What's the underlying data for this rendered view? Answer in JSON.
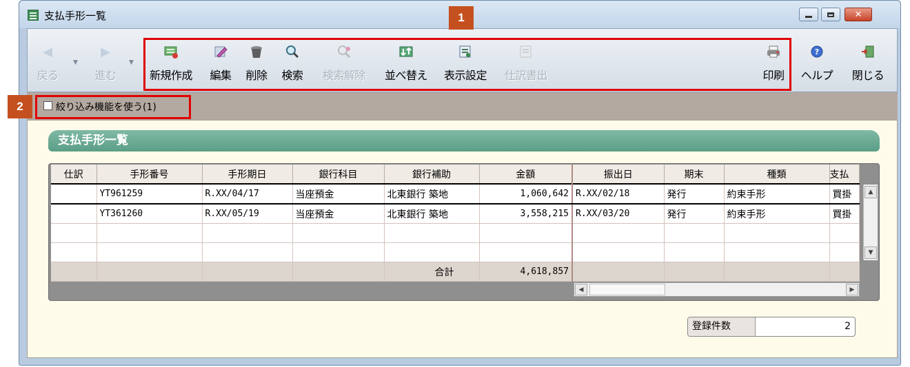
{
  "window": {
    "title": "支払手形一覧",
    "close_glyph": "✕"
  },
  "toolbar": {
    "back": "戻る",
    "forward": "進む",
    "new": "新規作成",
    "edit": "編集",
    "delete": "削除",
    "search": "検索",
    "clear_search": "検索解除",
    "sort": "並べ替え",
    "display_settings": "表示設定",
    "journal_output": "仕訳書出",
    "print": "印刷",
    "help": "ヘルプ",
    "close": "閉じる"
  },
  "markers": {
    "m1": "1",
    "m2": "2"
  },
  "filter": {
    "label": "絞り込み機能を使う(1)",
    "checked": false
  },
  "section": {
    "title": "支払手形一覧"
  },
  "grid": {
    "columns": [
      "仕訳",
      "手形番号",
      "手形期日",
      "銀行科目",
      "銀行補助",
      "金額",
      "振出日",
      "期末",
      "種類",
      "支払"
    ],
    "rows": [
      {
        "journal": "",
        "number": "YT961259",
        "due": "R.XX/04/17",
        "bank_account": "当座預金",
        "bank_sub": "北東銀行 築地",
        "amount": "1,060,642",
        "issue": "R.XX/02/18",
        "term": "発行",
        "kind": "約束手形",
        "payee": "買掛"
      },
      {
        "journal": "",
        "number": "YT361260",
        "due": "R.XX/05/19",
        "bank_account": "当座預金",
        "bank_sub": "北東銀行 築地",
        "amount": "3,558,215",
        "issue": "R.XX/03/20",
        "term": "発行",
        "kind": "約束手形",
        "payee": "買掛"
      }
    ],
    "total_label": "合計",
    "total_amount": "4,618,857"
  },
  "count": {
    "label": "登録件数",
    "value": "2"
  },
  "icons": {
    "back": "left-arrow-icon",
    "forward": "right-arrow-icon",
    "new": "new-document-icon",
    "edit": "pencil-icon",
    "delete": "trash-icon",
    "search": "magnifier-icon",
    "clear_search": "magnifier-clear-icon",
    "sort": "sort-icon",
    "display_settings": "settings-sheet-icon",
    "journal_output": "journal-export-icon",
    "print": "printer-icon",
    "help": "help-icon",
    "close": "exit-door-icon"
  },
  "colors": {
    "accent_red": "#e00000",
    "marker_orange": "#c5501f",
    "section_green": "#5b9e87"
  }
}
